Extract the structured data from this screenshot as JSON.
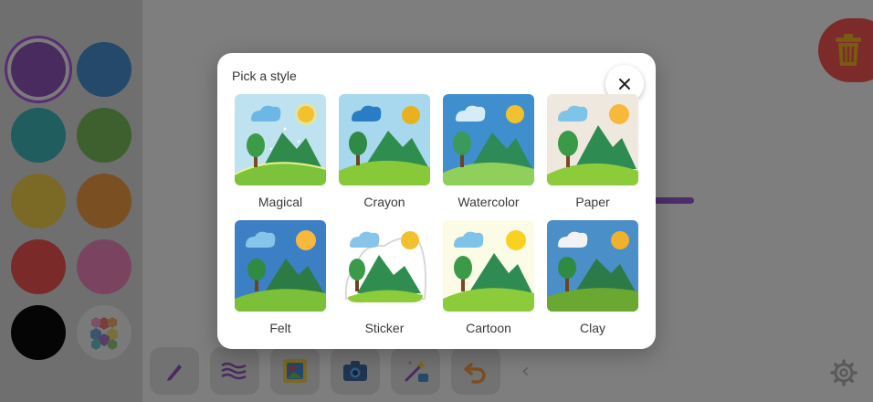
{
  "dialog": {
    "title": "Pick a style",
    "close_icon": "close-icon",
    "styles": [
      {
        "label": "Magical"
      },
      {
        "label": "Crayon"
      },
      {
        "label": "Watercolor"
      },
      {
        "label": "Paper"
      },
      {
        "label": "Felt"
      },
      {
        "label": "Sticker"
      },
      {
        "label": "Cartoon"
      },
      {
        "label": "Clay"
      }
    ]
  },
  "palette": {
    "colors": [
      "#4a2b60",
      "#25496b",
      "#1f5d5f",
      "#3e5f2e",
      "#7a6a25",
      "#7a4f22",
      "#7a2a29",
      "#7a4461",
      "#050505"
    ],
    "selected": "#4a2b60",
    "custom_icon": "hexagon-palette-icon"
  },
  "toolbar": {
    "tools": [
      "pen-icon",
      "brush-waves-icon",
      "sticker-image-icon",
      "camera-icon",
      "ai-magic-icon",
      "undo-icon"
    ]
  },
  "colors": {
    "overlay": "#7b7b7b",
    "dialog_bg": "#ffffff",
    "trash_bg": "#7c2a2a",
    "trash_icon": "#7a5a12"
  }
}
